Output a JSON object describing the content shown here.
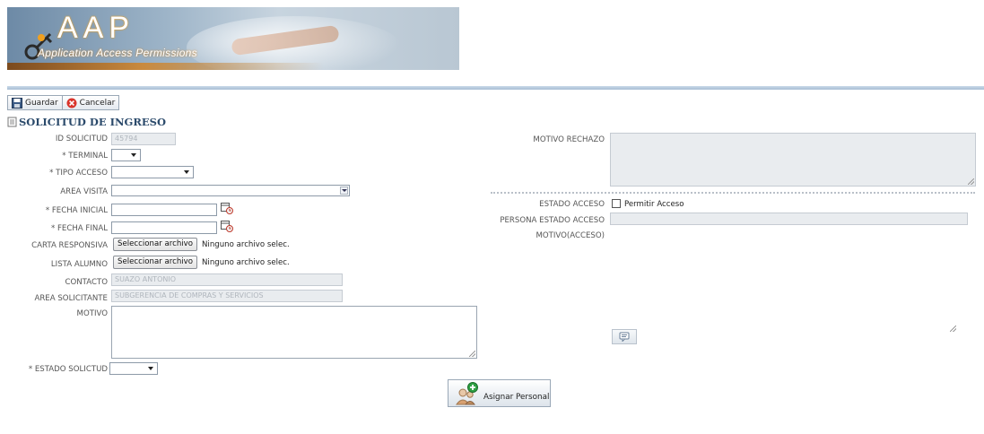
{
  "header": {
    "logo_text": "AAP",
    "logo_subtitle": "Application Access Permissions"
  },
  "toolbar": {
    "save_label": "Guardar",
    "cancel_label": "Cancelar"
  },
  "section_title": "SOLICITUD DE INGRESO",
  "form": {
    "id_solicitud": {
      "label": "ID SOLICITUD",
      "value": "45794"
    },
    "terminal": {
      "label": "* TERMINAL",
      "value": ""
    },
    "tipo_acceso": {
      "label": "* TIPO ACCESO",
      "value": ""
    },
    "area_visita": {
      "label": "AREA VISITA",
      "value": ""
    },
    "fecha_inicial": {
      "label": "* FECHA INICIAL",
      "value": ""
    },
    "fecha_final": {
      "label": "* FECHA FINAL",
      "value": ""
    },
    "carta_responsiva": {
      "label": "CARTA RESPONSIVA",
      "button": "Seleccionar archivo",
      "status": "Ninguno archivo selec."
    },
    "lista_alumno": {
      "label": "LISTA ALUMNO",
      "button": "Seleccionar archivo",
      "status": "Ninguno archivo selec."
    },
    "contacto": {
      "label": "CONTACTO",
      "value": "SUAZO ANTONIO"
    },
    "area_solicitante": {
      "label": "AREA SOLICITANTE",
      "value": "SUBGERENCIA DE COMPRAS Y SERVICIOS"
    },
    "motivo": {
      "label": "MOTIVO",
      "value": ""
    },
    "estado_solicitud": {
      "label": "* ESTADO SOLICTUD",
      "value": ""
    }
  },
  "right": {
    "motivo_rechazo": {
      "label": "MOTIVO RECHAZO",
      "value": ""
    },
    "estado_acceso": {
      "label": "ESTADO ACCESO",
      "checkbox_label": "Permitir Acceso",
      "checked": false
    },
    "persona_estado_acceso": {
      "label": "PERSONA ESTADO ACCESO",
      "value": ""
    },
    "motivo_acceso": {
      "label": "MOTIVO(ACCESO)",
      "value": ""
    }
  },
  "assign_button": {
    "label": "Asignar Personal"
  },
  "icons": [
    "save-icon",
    "cancel-icon",
    "document-icon",
    "calendar-icon",
    "comment-icon",
    "add-person-icon"
  ]
}
